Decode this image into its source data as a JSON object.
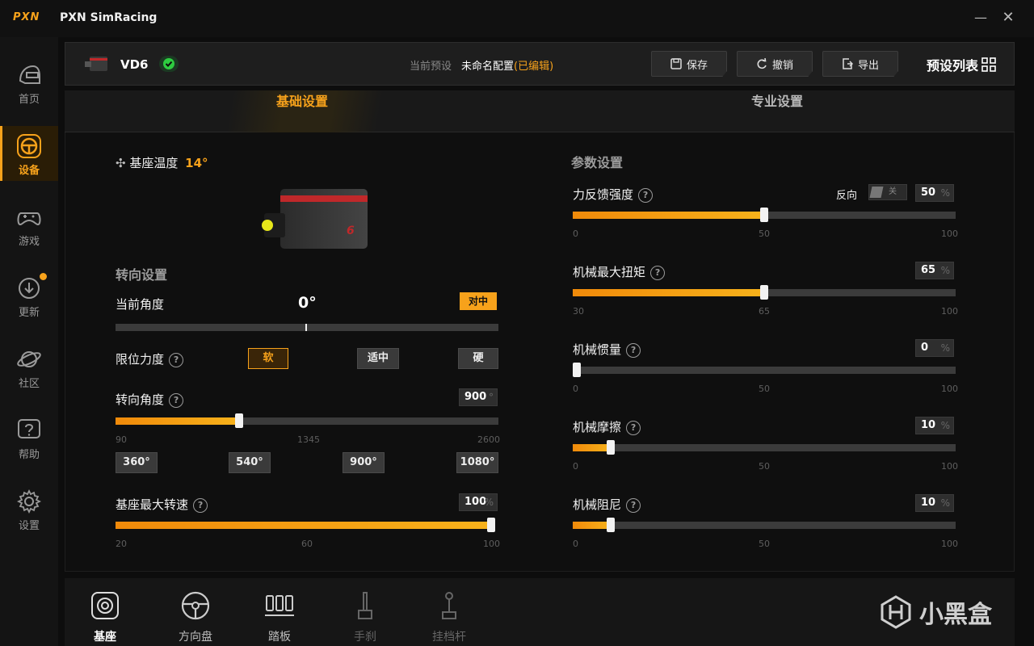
{
  "app": {
    "logo": "PXN",
    "title": "PXN SimRacing"
  },
  "window": {
    "minimize": "—",
    "close": "✕"
  },
  "sidebar": {
    "items": [
      {
        "label": "首页",
        "icon": "helmet-icon",
        "active": false
      },
      {
        "label": "设备",
        "icon": "steering-wheel-icon",
        "active": true
      },
      {
        "label": "游戏",
        "icon": "gamepad-icon",
        "active": false
      },
      {
        "label": "更新",
        "icon": "download-icon",
        "active": false,
        "badge": true
      },
      {
        "label": "社区",
        "icon": "planet-icon",
        "active": false
      },
      {
        "label": "帮助",
        "icon": "help-icon",
        "active": false
      },
      {
        "label": "设置",
        "icon": "gear-icon",
        "active": false
      }
    ]
  },
  "device": {
    "name": "VD6",
    "connected": true,
    "preset_label": "当前预设",
    "preset_name": "未命名配置",
    "preset_edited": "(已编辑)",
    "save": "保存",
    "undo": "撤销",
    "export": "导出",
    "preset_list": "预设列表"
  },
  "tabs": {
    "basic": "基础设置",
    "pro": "专业设置"
  },
  "left": {
    "temp_label": "基座温度",
    "temp_value": "14°",
    "steering_title": "转向设置",
    "current_angle_label": "当前角度",
    "current_angle_value": "0°",
    "center_button": "对中",
    "limit_force_label": "限位力度",
    "limit_options": [
      "软",
      "适中",
      "硬"
    ],
    "limit_selected": 0,
    "steer_angle_label": "转向角度",
    "steer_angle_value": "900",
    "steer_angle_unit": "°",
    "steer_angle_min": 90,
    "steer_angle_max": 2600,
    "steer_angle_ticks": [
      "90",
      "1345",
      "2600"
    ],
    "steer_presets": [
      "360°",
      "540°",
      "900°",
      "1080°"
    ],
    "max_speed_label": "基座最大转速",
    "max_speed_value": "100",
    "max_speed_unit": "%",
    "max_speed_min": 20,
    "max_speed_max": 100,
    "max_speed_ticks": [
      "20",
      "60",
      "100"
    ]
  },
  "right": {
    "params_title": "参数设置",
    "reverse_label": "反向",
    "reverse_toggle": "关",
    "sliders": [
      {
        "label": "力反馈强度",
        "value": "50",
        "unit": "%",
        "min": 0,
        "max": 100,
        "ticks": [
          "0",
          "50",
          "100"
        ]
      },
      {
        "label": "机械最大扭矩",
        "value": "65",
        "unit": "%",
        "min": 30,
        "max": 100,
        "ticks": [
          "30",
          "65",
          "100"
        ]
      },
      {
        "label": "机械惯量",
        "value": "0",
        "unit": "%",
        "min": 0,
        "max": 100,
        "ticks": [
          "0",
          "50",
          "100"
        ]
      },
      {
        "label": "机械摩擦",
        "value": "10",
        "unit": "%",
        "min": 0,
        "max": 100,
        "ticks": [
          "0",
          "50",
          "100"
        ]
      },
      {
        "label": "机械阻尼",
        "value": "10",
        "unit": "%",
        "min": 0,
        "max": 100,
        "ticks": [
          "0",
          "50",
          "100"
        ]
      }
    ]
  },
  "bottom": {
    "items": [
      {
        "label": "基座",
        "icon": "wheelbase-icon",
        "state": "active"
      },
      {
        "label": "方向盘",
        "icon": "steering-wheel-icon",
        "state": "normal"
      },
      {
        "label": "踏板",
        "icon": "pedals-icon",
        "state": "normal"
      },
      {
        "label": "手刹",
        "icon": "handbrake-icon",
        "state": "disabled"
      },
      {
        "label": "挂档杆",
        "icon": "shifter-icon",
        "state": "disabled"
      }
    ]
  },
  "watermark": "小黑盒",
  "colors": {
    "accent": "#f7a21b",
    "bg": "#0d0d0d",
    "panel": "#1e1e1e",
    "ok": "#2ecc40"
  }
}
